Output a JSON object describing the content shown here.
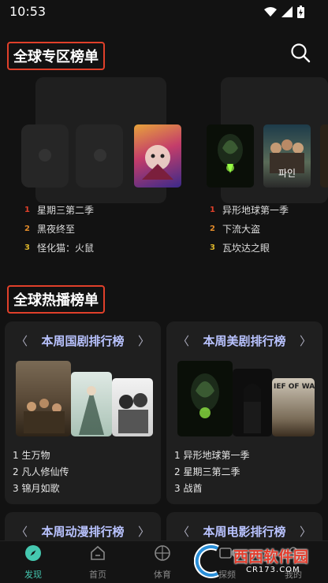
{
  "status": {
    "time": "10:53"
  },
  "global_zone": {
    "title": "全球专区榜单",
    "cards": [
      {
        "items": [
          {
            "rank": "1",
            "name": "星期三第二季"
          },
          {
            "rank": "2",
            "name": "黑夜终至"
          },
          {
            "rank": "3",
            "name": "怪化猫：火鼠"
          }
        ]
      },
      {
        "items": [
          {
            "rank": "1",
            "name": "异形地球第一季"
          },
          {
            "rank": "2",
            "name": "下流大盗"
          },
          {
            "rank": "3",
            "name": "瓦坎达之眼"
          }
        ]
      }
    ],
    "poster_text": {
      "p2": "파인"
    }
  },
  "hot_zone": {
    "title": "全球热播榜单",
    "charts": [
      {
        "title": "本周国剧排行榜",
        "items": [
          "1 生万物",
          "2 凡人修仙传",
          "3 锦月如歌"
        ]
      },
      {
        "title": "本周美剧排行榜",
        "items": [
          "1 异形地球第一季",
          "2 星期三第二季",
          "3 战酋"
        ]
      },
      {
        "title": "本周动漫排行榜"
      },
      {
        "title": "本周电影排行榜"
      }
    ],
    "arrows": {
      "left": "〈",
      "right": "〉"
    },
    "poster_text": {
      "war": "IEF OF WAR"
    }
  },
  "nav": {
    "items": [
      {
        "label": "发现",
        "icon": "compass-icon",
        "active": true
      },
      {
        "label": "首页",
        "icon": "home-icon"
      },
      {
        "label": "体育",
        "icon": "basketball-icon"
      },
      {
        "label": "探频",
        "icon": "video-icon"
      },
      {
        "label": "我的",
        "icon": "user-icon"
      }
    ]
  },
  "watermark": {
    "text": "西西软件园",
    "sub": "CR173.COM"
  },
  "colors": {
    "highlight_border": "#e0402a",
    "accent": "#45c8b0",
    "chart_title": "#b9c3ff"
  }
}
